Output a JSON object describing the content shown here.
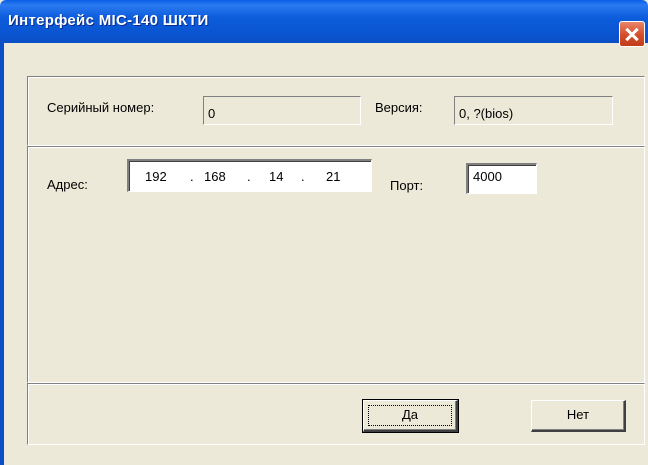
{
  "window": {
    "title": "Интерфейс MIC-140 ШКТИ"
  },
  "info": {
    "serial_label": "Серийный номер:",
    "serial_value": "0",
    "version_label": "Версия:",
    "version_value": "0, ?(bios)"
  },
  "network": {
    "address_label": "Адрес:",
    "ip_octets": [
      "192",
      "168",
      "14",
      "21"
    ],
    "ip_separator": ".",
    "port_label": "Порт:",
    "port_value": "4000"
  },
  "buttons": {
    "ok_label": "Да",
    "cancel_label": "Нет"
  }
}
